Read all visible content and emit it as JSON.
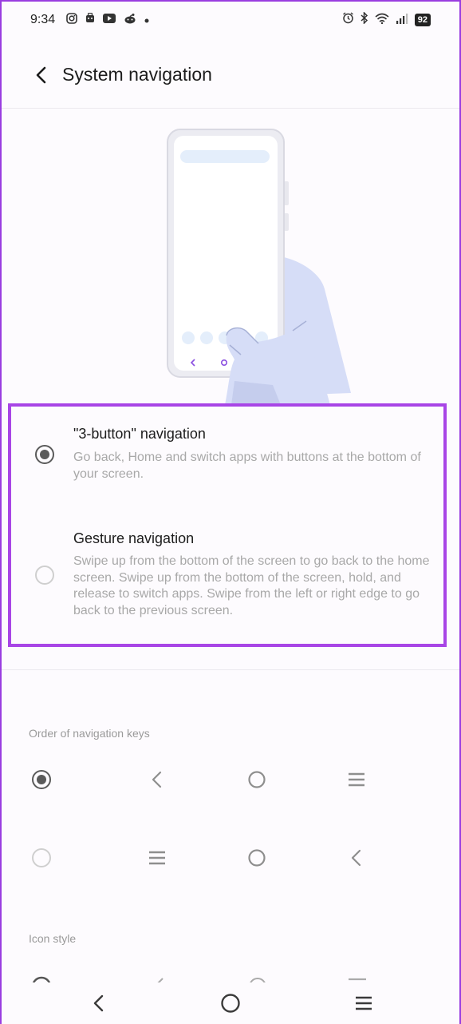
{
  "status_bar": {
    "time": "9:34",
    "left_icons": [
      "instagram-icon",
      "notification-icon",
      "youtube-icon",
      "reddit-icon",
      "dot-icon"
    ],
    "right_icons": [
      "alarm-icon",
      "bluetooth-icon",
      "wifi-icon",
      "signal-icon"
    ],
    "battery": "92"
  },
  "header": {
    "title": "System navigation",
    "back_icon": "back-arrow-icon"
  },
  "navigation_options": [
    {
      "title": "\"3-button\" navigation",
      "description": "Go back, Home and switch apps with buttons at the bottom of your screen.",
      "selected": true
    },
    {
      "title": "Gesture navigation",
      "description": "Swipe up from the bottom of the screen to go back to the home screen. Swipe up from the bottom of the screen, hold, and release to switch apps. Swipe from the left or right edge to go back to the previous screen.",
      "selected": false
    }
  ],
  "order_section": {
    "label": "Order of navigation keys",
    "rows": [
      {
        "selected": true,
        "keys": [
          "back-icon",
          "home-circle-icon",
          "menu-lines-icon"
        ]
      },
      {
        "selected": false,
        "keys": [
          "menu-lines-icon",
          "home-circle-icon",
          "back-icon"
        ]
      }
    ]
  },
  "icon_style_section": {
    "label": "Icon style"
  },
  "nav_bar": {
    "buttons": [
      "back-icon",
      "home-icon",
      "recents-icon"
    ]
  },
  "colors": {
    "highlight": "#a845e6",
    "radio_checked": "#5a5a5a",
    "illustration_hand": "#d6ddf7"
  }
}
